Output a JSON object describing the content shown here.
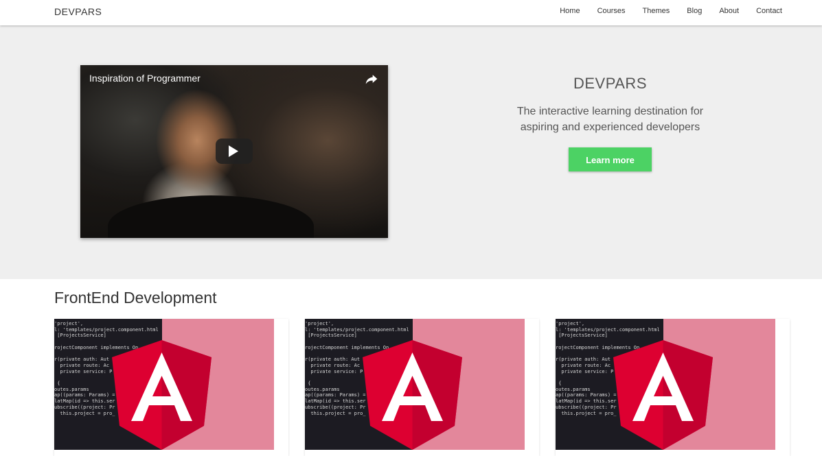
{
  "navbar": {
    "brand": "DEVPARS",
    "links": [
      "Home",
      "Courses",
      "Themes",
      "Blog",
      "About",
      "Contact"
    ]
  },
  "hero": {
    "video": {
      "title": "Inspiration of Programmer"
    },
    "title": "DEVPARS",
    "subtitle_line1": "The interactive learning destination for",
    "subtitle_line2": "aspiring and experienced developers",
    "cta_label": "Learn more"
  },
  "section": {
    "title": "FrontEnd Development",
    "cards": [
      {
        "image": "angular-logo-over-code"
      },
      {
        "image": "angular-logo-over-code"
      },
      {
        "image": "angular-logo-over-code"
      }
    ]
  },
  "code_lines": [
    "'project',",
    "l: 'templates/project.component.html",
    " [ProjectsService]",
    "",
    "rojectComponent implements On",
    "",
    "r(private auth: Aut",
    "  private route: Ac",
    "  private service: P",
    "",
    " {",
    "outes.params",
    "ap((params: Params) =",
    "latMap(id => this.ser",
    "ubscribe((project: Pr",
    "  this.project = pro_"
  ],
  "colors": {
    "accent_green": "#4cd264",
    "angular_red": "#c3002f",
    "angular_red_light": "#dd0031",
    "card_pink": "#e3879b",
    "hero_bg": "#efefef"
  }
}
